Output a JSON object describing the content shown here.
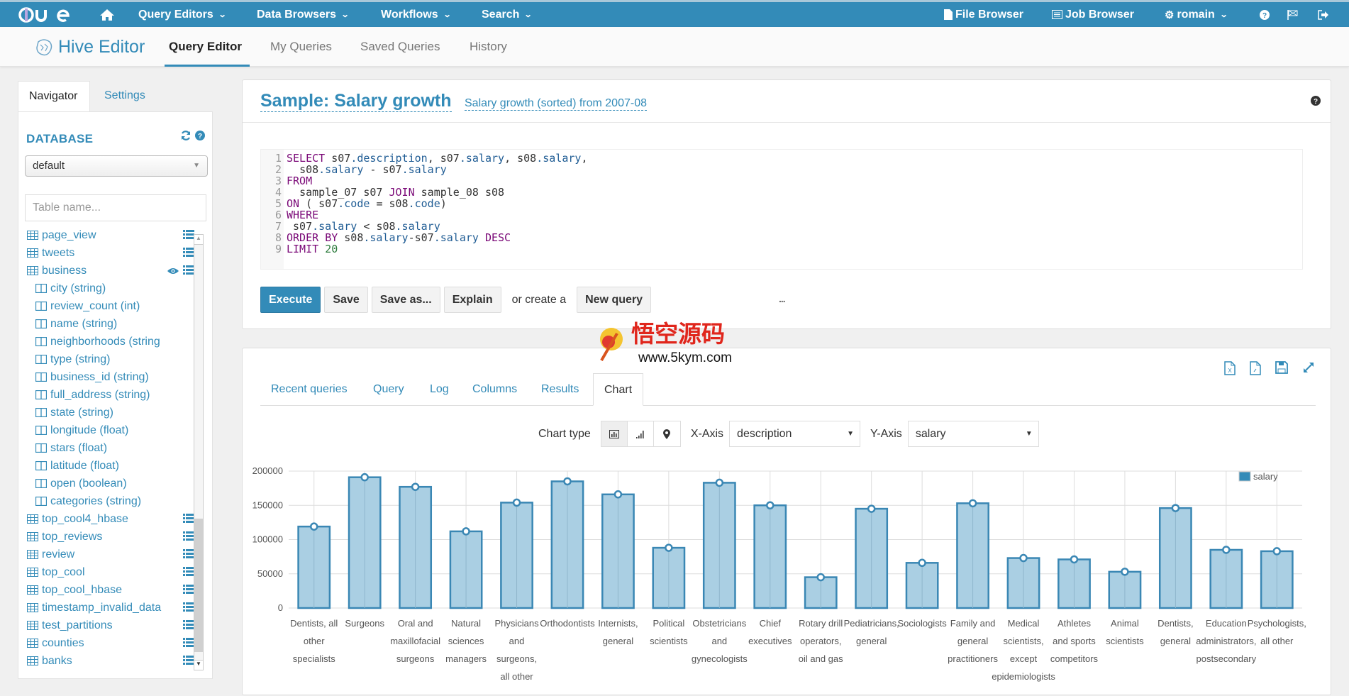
{
  "topnav": {
    "logo": "HUE",
    "items": [
      {
        "label": "Query Editors",
        "dropdown": true
      },
      {
        "label": "Data Browsers",
        "dropdown": true
      },
      {
        "label": "Workflows",
        "dropdown": true
      },
      {
        "label": "Search",
        "dropdown": true
      }
    ],
    "right": {
      "file_browser": "File Browser",
      "job_browser": "Job Browser",
      "user": "romain"
    }
  },
  "subnav": {
    "app_title": "Hive Editor",
    "tabs": [
      {
        "label": "Query Editor",
        "active": true
      },
      {
        "label": "My Queries",
        "active": false
      },
      {
        "label": "Saved Queries",
        "active": false
      },
      {
        "label": "History",
        "active": false
      }
    ]
  },
  "sidebar": {
    "tabs": [
      {
        "label": "Navigator",
        "active": true
      },
      {
        "label": "Settings",
        "active": false
      }
    ],
    "database_heading": "DATABASE",
    "database_selected": "default",
    "table_search_placeholder": "Table name...",
    "tree": [
      {
        "type": "table",
        "label": "page_view"
      },
      {
        "type": "table",
        "label": "tweets"
      },
      {
        "type": "table",
        "label": "business",
        "expanded": true
      },
      {
        "type": "column",
        "label": "city (string)"
      },
      {
        "type": "column",
        "label": "review_count (int)"
      },
      {
        "type": "column",
        "label": "name (string)"
      },
      {
        "type": "column",
        "label": "neighborhoods (string"
      },
      {
        "type": "column",
        "label": "type (string)"
      },
      {
        "type": "column",
        "label": "business_id (string)"
      },
      {
        "type": "column",
        "label": "full_address (string)"
      },
      {
        "type": "column",
        "label": "state (string)"
      },
      {
        "type": "column",
        "label": "longitude (float)"
      },
      {
        "type": "column",
        "label": "stars (float)"
      },
      {
        "type": "column",
        "label": "latitude (float)"
      },
      {
        "type": "column",
        "label": "open (boolean)"
      },
      {
        "type": "column",
        "label": "categories (string)"
      },
      {
        "type": "table",
        "label": "top_cool4_hbase"
      },
      {
        "type": "table",
        "label": "top_reviews"
      },
      {
        "type": "table",
        "label": "review"
      },
      {
        "type": "table",
        "label": "top_cool"
      },
      {
        "type": "table",
        "label": "top_cool_hbase"
      },
      {
        "type": "table",
        "label": "timestamp_invalid_data"
      },
      {
        "type": "table",
        "label": "test_partitions"
      },
      {
        "type": "table",
        "label": "counties"
      },
      {
        "type": "table",
        "label": "banks"
      }
    ]
  },
  "editor": {
    "title": "Sample: Salary growth",
    "description": "Salary growth (sorted) from 2007-08",
    "code_lines": [
      "SELECT s07.description, s07.salary, s08.salary,",
      "  s08.salary - s07.salary",
      "FROM",
      "  sample_07 s07 JOIN sample_08 s08",
      "ON ( s07.code = s08.code)",
      "WHERE",
      " s07.salary < s08.salary",
      "ORDER BY s08.salary-s07.salary DESC",
      "LIMIT 20"
    ],
    "buttons": {
      "execute": "Execute",
      "save": "Save",
      "save_as": "Save as...",
      "explain": "Explain",
      "or_create": "or create a",
      "new_query": "New query"
    },
    "more": "..."
  },
  "watermark": {
    "title": "悟空源码",
    "url": "www.5kym.com"
  },
  "results": {
    "tabs": [
      {
        "label": "Recent queries",
        "active": false
      },
      {
        "label": "Query",
        "active": false
      },
      {
        "label": "Log",
        "active": false
      },
      {
        "label": "Columns",
        "active": false
      },
      {
        "label": "Results",
        "active": false
      },
      {
        "label": "Chart",
        "active": true
      }
    ],
    "chart_type_label": "Chart type",
    "x_axis_label": "X-Axis",
    "x_axis_value": "description",
    "y_axis_label": "Y-Axis",
    "y_axis_value": "salary"
  },
  "colors": {
    "brand": "#338bb8",
    "bar_fill": "#aacfe3",
    "bar_stroke": "#3a87b4"
  },
  "chart_data": {
    "type": "bar",
    "title": "",
    "xlabel": "",
    "ylabel": "",
    "ylim": [
      0,
      200000
    ],
    "yticks": [
      0,
      50000,
      100000,
      150000,
      200000
    ],
    "grid": true,
    "legend": {
      "entries": [
        "salary"
      ],
      "placement": "top-right"
    },
    "categories": [
      "Dentists, all other specialists",
      "Surgeons",
      "Oral and maxillofacial surgeons",
      "Natural sciences managers",
      "Physicians and surgeons, all other",
      "Orthodontists",
      "Internists, general",
      "Political scientists",
      "Obstetricians and gynecologists",
      "Chief executives",
      "Rotary drill operators, oil and gas",
      "Pediatricians, general",
      "Sociologists",
      "Family and general practitioners",
      "Medical scientists, except epidemiologists",
      "Athletes and sports competitors",
      "Animal scientists",
      "Dentists, general",
      "Education administrators, postsecondary",
      "Psychologists, all other"
    ],
    "label_lines": [
      [
        "Dentists, all",
        "other",
        "specialists"
      ],
      [
        "Surgeons"
      ],
      [
        "Oral and",
        "maxillofacial",
        "surgeons"
      ],
      [
        "Natural",
        "sciences",
        "managers"
      ],
      [
        "Physicians",
        "and",
        "surgeons,",
        "all other"
      ],
      [
        "Orthodontists"
      ],
      [
        "Internists,",
        "general"
      ],
      [
        "Political",
        "scientists"
      ],
      [
        "Obstetricians",
        "and",
        "gynecologists"
      ],
      [
        "Chief",
        "executives"
      ],
      [
        "Rotary drill",
        "operators,",
        "oil and gas"
      ],
      [
        "Pediatricians,",
        "general"
      ],
      [
        "Sociologists"
      ],
      [
        "Family and",
        "general",
        "practitioners"
      ],
      [
        "Medical",
        "scientists,",
        "except",
        "epidemiologists"
      ],
      [
        "Athletes",
        "and sports",
        "competitors"
      ],
      [
        "Animal",
        "scientists"
      ],
      [
        "Dentists,",
        "general"
      ],
      [
        "Education",
        "administrators,",
        "postsecondary"
      ],
      [
        "Psychologists,",
        "all other"
      ]
    ],
    "series": [
      {
        "name": "salary",
        "values": [
          119000,
          191000,
          177000,
          112000,
          154000,
          185000,
          166000,
          88000,
          183000,
          150000,
          45000,
          145000,
          66000,
          153000,
          73000,
          71000,
          53000,
          146000,
          85000,
          83000
        ]
      }
    ]
  }
}
